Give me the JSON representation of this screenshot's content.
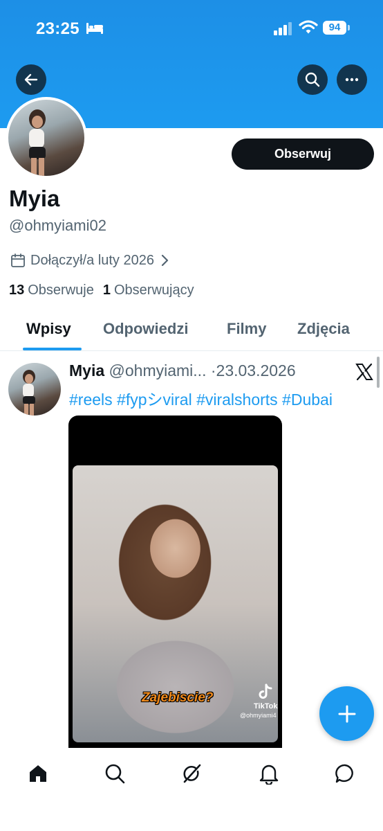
{
  "status_bar": {
    "time": "23:25",
    "battery": "94"
  },
  "header": {
    "back_icon": "arrow-left-icon",
    "search_icon": "search-icon",
    "more_icon": "more-horizontal-icon",
    "banner_color": "#1d9bf0"
  },
  "profile": {
    "name": "Myia",
    "handle": "@ohmyiami02",
    "follow_label": "Obserwuj",
    "joined": "Dołączył/a luty 2026",
    "following_count": "13",
    "following_label": "Obserwuje",
    "followers_count": "1",
    "followers_label": "Obserwujący"
  },
  "tabs": [
    {
      "label": "Wpisy",
      "active": true
    },
    {
      "label": "Odpowiedzi",
      "active": false
    },
    {
      "label": "Filmy",
      "active": false
    },
    {
      "label": "Zdjęcia",
      "active": false
    }
  ],
  "post": {
    "author_name": "Myia",
    "author_handle": "@ohmyiami...",
    "date": "23.03.2026",
    "hashtags": "#reels #fypシviral #viralshorts #Dubai",
    "video": {
      "caption": "Zajebiscie?",
      "tiktok_label": "TikTok",
      "tiktok_handle": "@ohmyiami4"
    }
  },
  "bottom_nav": [
    "home-icon",
    "search-icon",
    "grok-icon",
    "notifications-icon",
    "messages-icon"
  ],
  "accent_color": "#1d9bf0"
}
